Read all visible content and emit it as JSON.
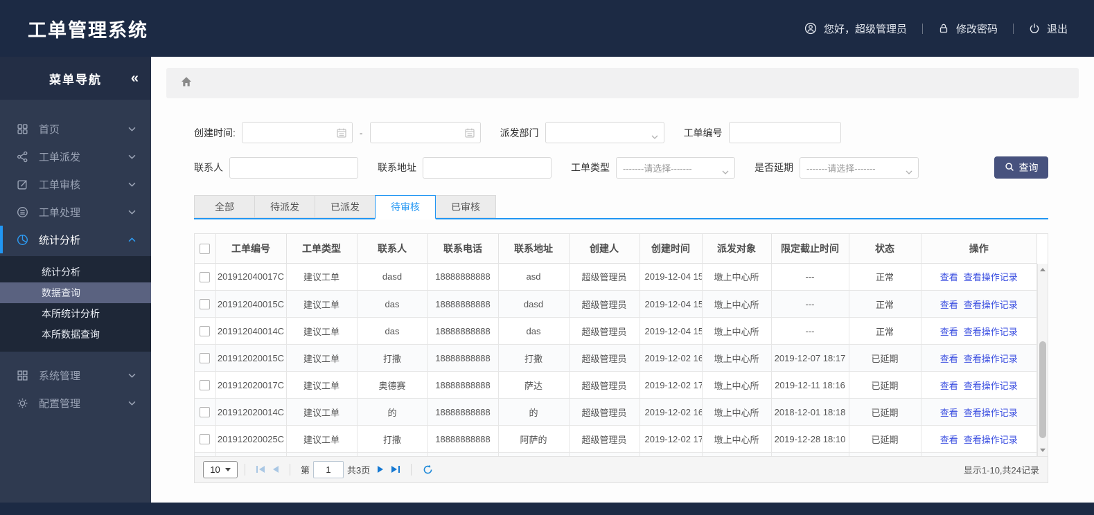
{
  "header": {
    "title": "工单管理系统",
    "greeting": "您好，超级管理员",
    "change_password": "修改密码",
    "logout": "退出"
  },
  "sidebar": {
    "title": "菜单导航",
    "collapse_glyph": "«",
    "items": [
      {
        "label": "首页"
      },
      {
        "label": "工单派发"
      },
      {
        "label": "工单审核"
      },
      {
        "label": "工单处理"
      },
      {
        "label": "统计分析",
        "active": true,
        "expanded": true,
        "children": [
          "统计分析",
          "数据查询",
          "本所统计分析",
          "本所数据查询"
        ],
        "selected_child": "数据查询"
      },
      {
        "label": "系统管理"
      },
      {
        "label": "配置管理"
      }
    ]
  },
  "filters": {
    "create_time_label": "创建时间:",
    "date_separator": "-",
    "dispatch_dept_label": "派发部门",
    "order_no_label": "工单编号",
    "contact_label": "联系人",
    "address_label": "联系地址",
    "order_type_label": "工单类型",
    "delay_label": "是否延期",
    "select_placeholder": "-------请选择-------",
    "search_button": "查询"
  },
  "tabs": [
    {
      "label": "全部"
    },
    {
      "label": "待派发"
    },
    {
      "label": "已派发"
    },
    {
      "label": "待审核",
      "active": true
    },
    {
      "label": "已审核"
    }
  ],
  "table": {
    "columns": [
      "工单编号",
      "工单类型",
      "联系人",
      "联系电话",
      "联系地址",
      "创建人",
      "创建时间",
      "派发对象",
      "限定截止时间",
      "状态",
      "操作"
    ],
    "actions": [
      "查看",
      "查看操作记录"
    ],
    "rows": [
      {
        "order_no": "201912040017C",
        "type": "建议工单",
        "contact": "dasd",
        "phone": "18888888888",
        "address": "asd",
        "creator": "超级管理员",
        "created": "2019-12-04 15",
        "target": "墩上中心所",
        "deadline": "---",
        "status": "正常",
        "status_type": "normal"
      },
      {
        "order_no": "201912040015C",
        "type": "建议工单",
        "contact": "das",
        "phone": "18888888888",
        "address": "dasd",
        "creator": "超级管理员",
        "created": "2019-12-04 15",
        "target": "墩上中心所",
        "deadline": "---",
        "status": "正常",
        "status_type": "normal"
      },
      {
        "order_no": "201912040014C",
        "type": "建议工单",
        "contact": "das",
        "phone": "18888888888",
        "address": "das",
        "creator": "超级管理员",
        "created": "2019-12-04 15",
        "target": "墩上中心所",
        "deadline": "---",
        "status": "正常",
        "status_type": "normal"
      },
      {
        "order_no": "201912020015C",
        "type": "建议工单",
        "contact": "打撒",
        "phone": "18888888888",
        "address": "打撒",
        "creator": "超级管理员",
        "created": "2019-12-02 16",
        "target": "墩上中心所",
        "deadline": "2019-12-07 18:17",
        "status": "已延期",
        "status_type": "delayed"
      },
      {
        "order_no": "201912020017C",
        "type": "建议工单",
        "contact": "奥德赛",
        "phone": "18888888888",
        "address": "萨达",
        "creator": "超级管理员",
        "created": "2019-12-02 17",
        "target": "墩上中心所",
        "deadline": "2019-12-11 18:16",
        "status": "已延期",
        "status_type": "delayed"
      },
      {
        "order_no": "201912020014C",
        "type": "建议工单",
        "contact": "的",
        "phone": "18888888888",
        "address": "的",
        "creator": "超级管理员",
        "created": "2019-12-02 16",
        "target": "墩上中心所",
        "deadline": "2018-12-01 18:18",
        "status": "已延期",
        "status_type": "delayed"
      },
      {
        "order_no": "201912020025C",
        "type": "建议工单",
        "contact": "打撒",
        "phone": "18888888888",
        "address": "阿萨的",
        "creator": "超级管理员",
        "created": "2019-12-02 17",
        "target": "墩上中心所",
        "deadline": "2019-12-28 18:10",
        "status": "已延期",
        "status_type": "delayed"
      },
      {
        "order_no": "",
        "type": "",
        "contact": "",
        "phone": "",
        "address": "",
        "creator": "",
        "created": "",
        "target": "",
        "deadline": "",
        "status": "",
        "status_type": ""
      }
    ]
  },
  "pagination": {
    "page_size": "10",
    "page_prefix": "第",
    "current_page": "1",
    "total_pages": "共3页",
    "summary": "显示1-10,共24记录"
  },
  "colors": {
    "accent_blue": "#2196f3",
    "link_blue": "#3a4ee0",
    "status_normal_blue": "#2f4fe0",
    "status_delayed_red": "#e23c3c",
    "header_bg": "#1c2a44",
    "sidebar_bg": "#2f3a50",
    "submenu_bg": "#1e2737",
    "selected_submenu_bg": "#5a6280",
    "query_button_bg": "#47527e"
  }
}
